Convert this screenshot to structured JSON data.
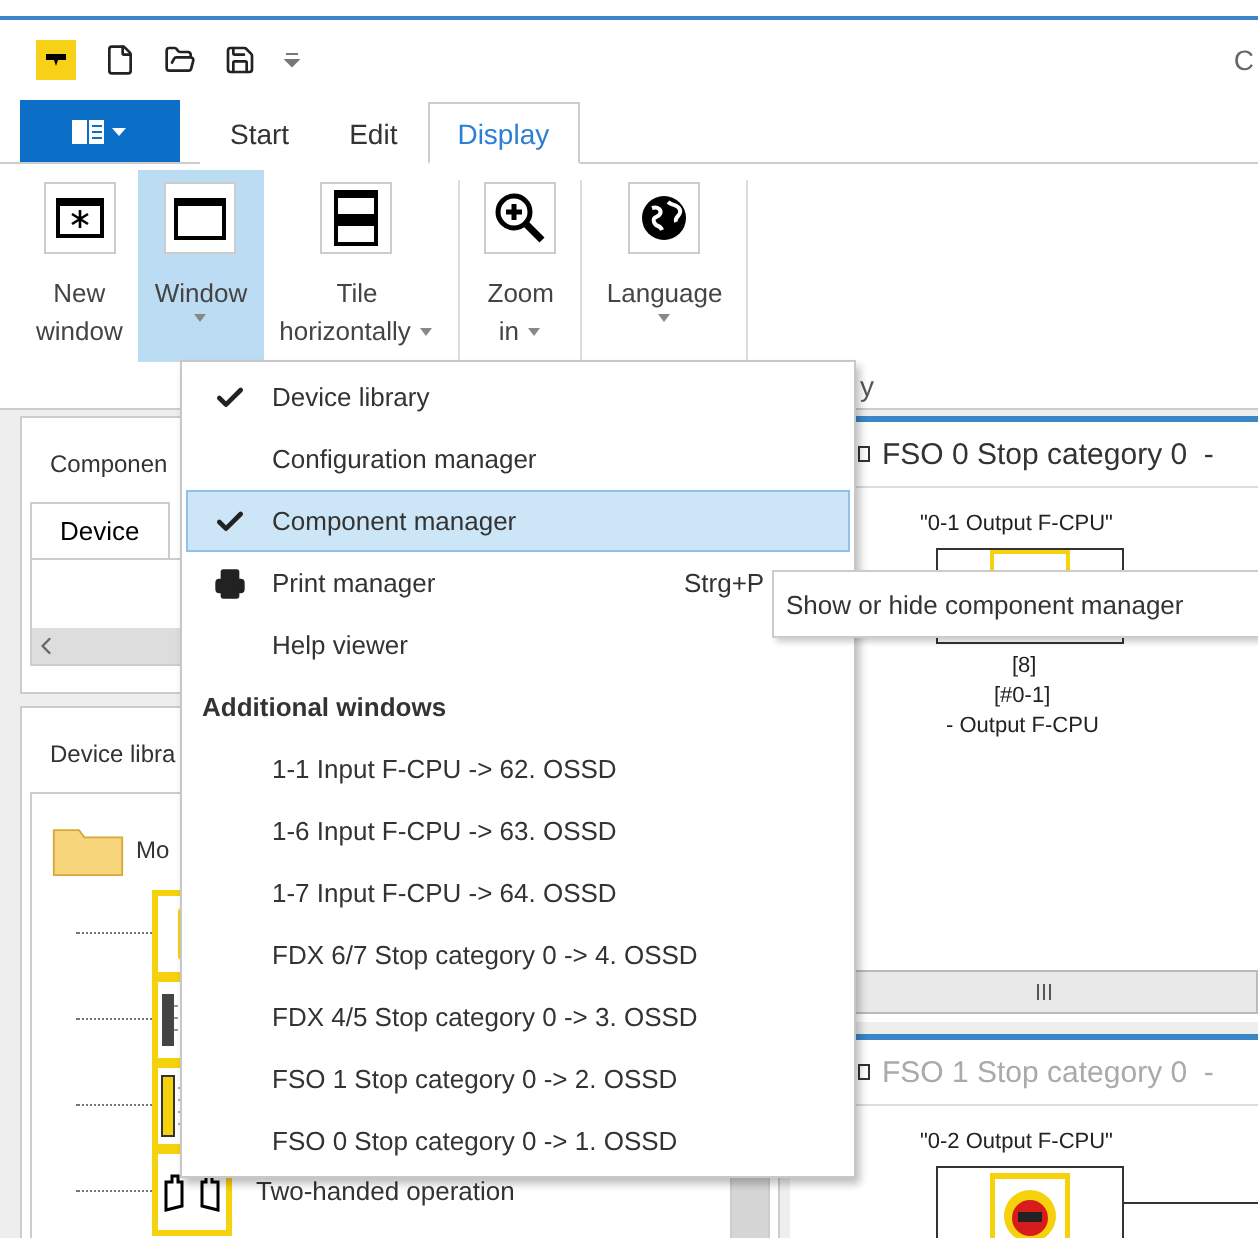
{
  "title_bar": {
    "title_fragment": "C"
  },
  "ribbon": {
    "tabs": [
      {
        "label": "Start",
        "selected": false
      },
      {
        "label": "Edit",
        "selected": false
      },
      {
        "label": "Display",
        "selected": true
      }
    ],
    "buttons": [
      {
        "kind": "new_window",
        "lines": [
          "New",
          "window"
        ],
        "dropdown": false,
        "pressed": false
      },
      {
        "kind": "window",
        "lines": [
          "Window"
        ],
        "dropdown": true,
        "pressed": true
      },
      {
        "kind": "tile",
        "lines": [
          "Tile",
          "horizontally"
        ],
        "dropdown": true,
        "pressed": false
      },
      {
        "kind": "zoom",
        "lines": [
          "Zoom",
          "in"
        ],
        "dropdown": true,
        "pressed": false
      },
      {
        "kind": "language",
        "lines": [
          "Language"
        ],
        "dropdown": true,
        "pressed": false
      }
    ],
    "group_label_fragment": "y"
  },
  "component_manager": {
    "title": "Componen",
    "tabs": [
      {
        "label": "Device",
        "selected": true
      }
    ]
  },
  "device_library": {
    "title": "Device libra",
    "tree": [
      {
        "label": "Mo",
        "expanded": true,
        "children": [
          {
            "kind": "estop"
          },
          {
            "kind": "light_curtain"
          },
          {
            "kind": "light_grid"
          },
          {
            "kind": "two_hand",
            "label": "Two-handed operation"
          }
        ]
      }
    ]
  },
  "editor_windows": [
    {
      "title": "FSO 0 Stop category 0  -",
      "active": true,
      "block": {
        "kind": "output",
        "name": "\"0-1 Output F-CPU\"",
        "lines": [
          "[8]",
          "[#0-1]",
          "- Output F-CPU"
        ]
      }
    },
    {
      "title": "FSO 1 Stop category 0  -",
      "active": false,
      "block": {
        "kind": "estop",
        "name": "\"0-2 Output F-CPU\""
      }
    }
  ],
  "menu": {
    "items": [
      {
        "kind": "item",
        "label": "Device library",
        "checked": true,
        "highlighted": false
      },
      {
        "kind": "item",
        "label": "Configuration manager",
        "checked": false,
        "highlighted": false
      },
      {
        "kind": "item",
        "label": "Component manager",
        "checked": true,
        "highlighted": true
      },
      {
        "kind": "print",
        "label": "Print manager",
        "shortcut": "Strg+P",
        "checked": false,
        "highlighted": false
      },
      {
        "kind": "item",
        "label": "Help viewer",
        "checked": false,
        "highlighted": false
      },
      {
        "kind": "header",
        "label": "Additional windows"
      },
      {
        "kind": "item",
        "label": "1-1 Input F-CPU  ->  62. OSSD",
        "checked": false,
        "highlighted": false
      },
      {
        "kind": "item",
        "label": "1-6 Input F-CPU  ->  63. OSSD",
        "checked": false,
        "highlighted": false
      },
      {
        "kind": "item",
        "label": "1-7 Input F-CPU  ->  64. OSSD",
        "checked": false,
        "highlighted": false
      },
      {
        "kind": "item",
        "label": "FDX 6/7 Stop category 0  ->  4. OSSD",
        "checked": false,
        "highlighted": false
      },
      {
        "kind": "item",
        "label": "FDX 4/5 Stop category 0  ->  3. OSSD",
        "checked": false,
        "highlighted": false
      },
      {
        "kind": "item",
        "label": "FSO 1 Stop category 0  ->  2. OSSD",
        "checked": false,
        "highlighted": false
      },
      {
        "kind": "item",
        "label": "FSO 0 Stop category 0  ->  1. OSSD",
        "checked": false,
        "highlighted": false
      }
    ]
  },
  "tooltip": {
    "text": "Show or hide component manager"
  }
}
